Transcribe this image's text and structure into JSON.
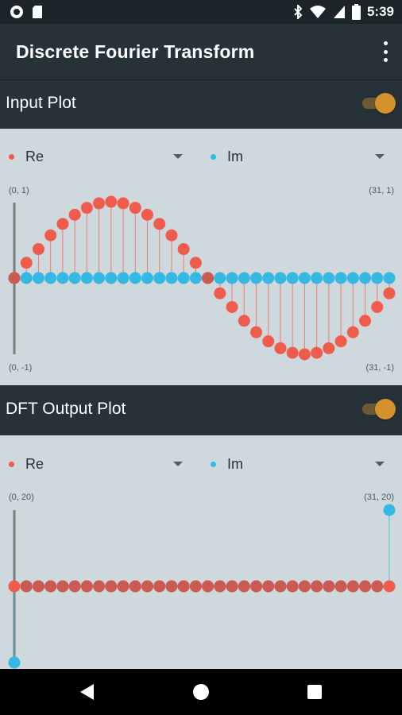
{
  "status_bar": {
    "time": "5:39"
  },
  "app_bar": {
    "title": "Discrete Fourier Transform"
  },
  "input_section": {
    "title": "Input Plot",
    "toggle_on": true,
    "re_label": "Re",
    "im_label": "Im",
    "top_left": "(0, 1)",
    "top_right": "(31, 1)",
    "bottom_left": "(0, -1)",
    "bottom_right": "(31, -1)"
  },
  "output_section": {
    "title": "DFT Output Plot",
    "toggle_on": true,
    "re_label": "Re",
    "im_label": "Im",
    "top_left": "(0, 20)",
    "top_right": "(31, 20)"
  },
  "colors": {
    "re": "#ef5b4c",
    "im": "#35b8e3",
    "overlap": "#c85b52",
    "accent": "#d4922e"
  },
  "chart_data": [
    {
      "type": "scatter",
      "title": "Input Plot",
      "xlabel": "",
      "ylabel": "",
      "xlim": [
        0,
        31
      ],
      "ylim": [
        -1,
        1
      ],
      "x": [
        0,
        1,
        2,
        3,
        4,
        5,
        6,
        7,
        8,
        9,
        10,
        11,
        12,
        13,
        14,
        15,
        16,
        17,
        18,
        19,
        20,
        21,
        22,
        23,
        24,
        25,
        26,
        27,
        28,
        29,
        30,
        31
      ],
      "series": [
        {
          "name": "Re",
          "values": [
            0,
            0.2,
            0.38,
            0.56,
            0.71,
            0.83,
            0.92,
            0.98,
            1,
            0.98,
            0.92,
            0.83,
            0.71,
            0.56,
            0.38,
            0.2,
            0,
            -0.2,
            -0.38,
            -0.56,
            -0.71,
            -0.83,
            -0.92,
            -0.98,
            -1,
            -0.98,
            -0.92,
            -0.83,
            -0.71,
            -0.56,
            -0.38,
            -0.2
          ]
        },
        {
          "name": "Im",
          "values": [
            0,
            0,
            0,
            0,
            0,
            0,
            0,
            0,
            0,
            0,
            0,
            0,
            0,
            0,
            0,
            0,
            0,
            0,
            0,
            0,
            0,
            0,
            0,
            0,
            0,
            0,
            0,
            0,
            0,
            0,
            0,
            0
          ]
        }
      ]
    },
    {
      "type": "scatter",
      "title": "DFT Output Plot",
      "xlabel": "",
      "ylabel": "",
      "xlim": [
        0,
        31
      ],
      "ylim": [
        -20,
        20
      ],
      "x": [
        0,
        1,
        2,
        3,
        4,
        5,
        6,
        7,
        8,
        9,
        10,
        11,
        12,
        13,
        14,
        15,
        16,
        17,
        18,
        19,
        20,
        21,
        22,
        23,
        24,
        25,
        26,
        27,
        28,
        29,
        30,
        31
      ],
      "series": [
        {
          "name": "Re",
          "values": [
            0,
            0,
            0,
            0,
            0,
            0,
            0,
            0,
            0,
            0,
            0,
            0,
            0,
            0,
            0,
            0,
            0,
            0,
            0,
            0,
            0,
            0,
            0,
            0,
            0,
            0,
            0,
            0,
            0,
            0,
            0,
            0
          ]
        },
        {
          "name": "Im",
          "values": [
            -16,
            0,
            0,
            0,
            0,
            0,
            0,
            0,
            0,
            0,
            0,
            0,
            0,
            0,
            0,
            0,
            0,
            0,
            0,
            0,
            0,
            0,
            0,
            0,
            0,
            0,
            0,
            0,
            0,
            0,
            0,
            16
          ]
        }
      ]
    }
  ]
}
